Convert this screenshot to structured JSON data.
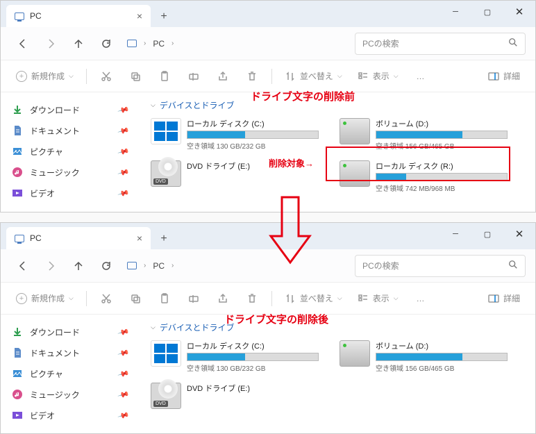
{
  "tab_title": "PC",
  "breadcrumb": "PC",
  "search_placeholder": "PCの検索",
  "toolbar": {
    "new": "新規作成",
    "sort": "並べ替え",
    "view": "表示",
    "details": "詳細",
    "more": "…"
  },
  "sidebar": [
    {
      "label": "ダウンロード",
      "icon": "download",
      "color": "#2e9e4f"
    },
    {
      "label": "ドキュメント",
      "icon": "document",
      "color": "#5b8bc9"
    },
    {
      "label": "ピクチャ",
      "icon": "pictures",
      "color": "#3b8fd6"
    },
    {
      "label": "ミュージック",
      "icon": "music",
      "color": "#d94f8c"
    },
    {
      "label": "ビデオ",
      "icon": "videos",
      "color": "#7b4fd9"
    }
  ],
  "section_title": "デバイスとドライブ",
  "before": {
    "heading": "ドライブ文字の削除前",
    "target_label": "削除対象→",
    "drives": [
      {
        "name": "ローカル ディスク (C:)",
        "free": "空き領域 130 GB/232 GB",
        "fill": 44,
        "type": "win"
      },
      {
        "name": "ボリューム (D:)",
        "free": "空き領域 156 GB/465 GB",
        "fill": 66,
        "type": "ssd"
      },
      {
        "name": "DVD ドライブ (E:)",
        "free": "",
        "fill": 0,
        "type": "dvd",
        "nobar": true
      },
      {
        "name": "ローカル ディスク (R:)",
        "free": "空き領域 742 MB/968 MB",
        "fill": 23,
        "type": "ssd"
      }
    ]
  },
  "after": {
    "heading": "ドライブ文字の削除後",
    "drives": [
      {
        "name": "ローカル ディスク (C:)",
        "free": "空き領域 130 GB/232 GB",
        "fill": 44,
        "type": "win"
      },
      {
        "name": "ボリューム (D:)",
        "free": "空き領域 156 GB/465 GB",
        "fill": 66,
        "type": "ssd"
      },
      {
        "name": "DVD ドライブ (E:)",
        "free": "",
        "fill": 0,
        "type": "dvd",
        "nobar": true
      }
    ]
  }
}
